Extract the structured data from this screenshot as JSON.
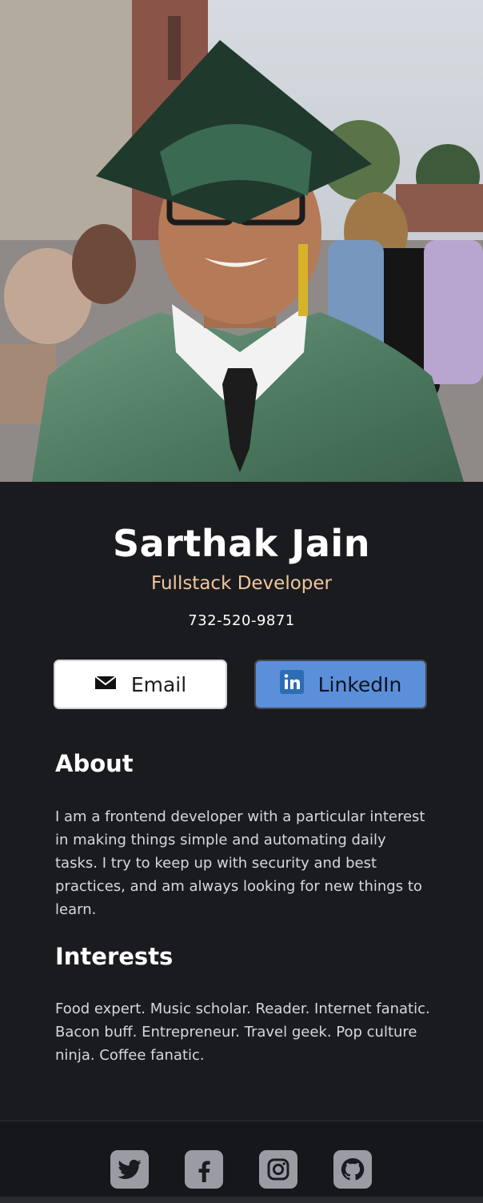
{
  "profile": {
    "name": "Sarthak Jain",
    "role": "Fullstack Developer",
    "phone": "732-520-9871"
  },
  "buttons": {
    "email_label": "Email",
    "linkedin_label": "LinkedIn"
  },
  "about": {
    "title": "About",
    "text": "I am a frontend developer with a particular interest in making things simple and automating daily tasks. I try to keep up with security and best practices, and am always looking for new things to learn."
  },
  "interests": {
    "title": "Interests",
    "text": "Food expert. Music scholar. Reader. Internet fanatic. Bacon buff. Entrepreneur. Travel geek. Pop culture ninja. Coffee fanatic."
  },
  "footer": {
    "icons": [
      "twitter-icon",
      "facebook-icon",
      "instagram-icon",
      "github-icon"
    ]
  },
  "colors": {
    "background": "#1a1b1f",
    "role_accent": "#f0c79b",
    "linkedin_button": "#5b8fd9",
    "social_icon_bg": "#9b9ca3"
  }
}
